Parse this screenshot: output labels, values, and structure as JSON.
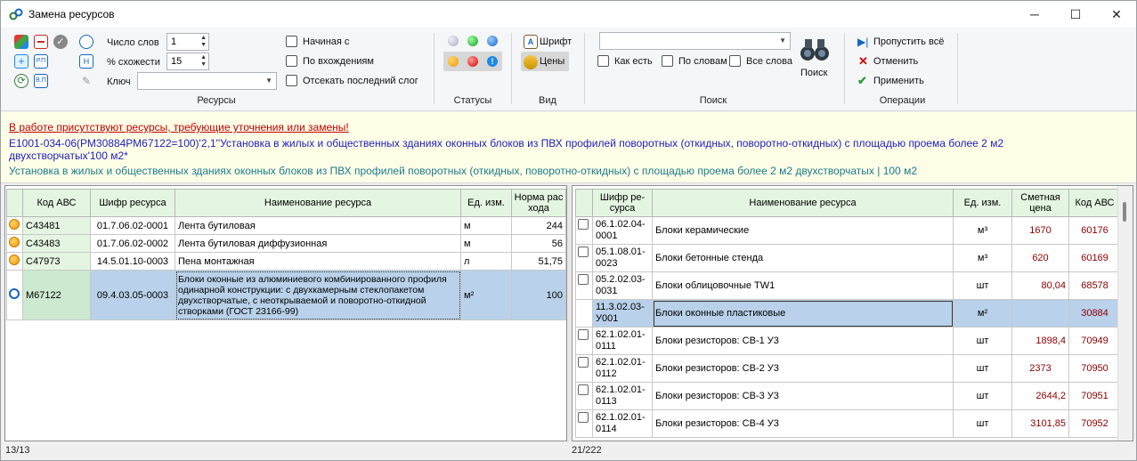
{
  "window": {
    "title": "Замена ресурсов",
    "minimize": "─",
    "maximize": "☐",
    "close": "✕"
  },
  "ribbon": {
    "resources": {
      "group_title": "Ресурсы",
      "word_count_label": "Число слов",
      "word_count_value": "1",
      "similarity_label": "% схожести",
      "similarity_value": "15",
      "key_label": "Ключ",
      "key_value": "",
      "starts_with_label": "Начиная с",
      "by_occurrence_label": "По вхождениям",
      "cut_last_syllable_label": "Отсекать последний слог",
      "small_buttons": [
        "Р.П",
        "В.П",
        "Н"
      ]
    },
    "statuses": {
      "group_title": "Статусы"
    },
    "view": {
      "group_title": "Вид",
      "font_label": "Шрифт",
      "prices_label": "Цены"
    },
    "search": {
      "group_title": "Поиск",
      "as_is_label": "Как есть",
      "by_words_label": "По словам",
      "all_words_label": "Все слова",
      "search_button": "Поиск",
      "search_value": ""
    },
    "operations": {
      "group_title": "Операции",
      "skip_all": "Пропустить всё",
      "cancel": "Отменить",
      "apply": "Применить"
    }
  },
  "info": {
    "warning": "В работе присутствуют ресурсы, требующие уточнения или замены!",
    "formula": "Е1001-034-06(РМ30884РМ67122=100)'2,1''Установка в жилых и общественных зданиях оконных блоков из ПВХ профилей поворотных (откидных, поворотно-откидных) с площадью проема более 2 м2 двухстворчатых'100 м2*",
    "description": "Установка в жилых и общественных зданиях оконных блоков из ПВХ профилей поворотных (откидных, поворотно-откидных) с площадью проема более 2 м2 двухстворчатых   |   100 м2"
  },
  "left_table": {
    "headers": [
      "Код АВС",
      "Шифр ресурса",
      "Наименование ресурса",
      "Ед. изм.",
      "Норма рас хода"
    ],
    "rows": [
      {
        "code": "С43481",
        "cipher": "01.7.06.02-0001",
        "name": "Лента бутиловая",
        "unit": "м",
        "norm": "244"
      },
      {
        "code": "С43483",
        "cipher": "01.7.06.02-0002",
        "name": "Лента бутиловая диффузионная",
        "unit": "м",
        "norm": "56"
      },
      {
        "code": "С47973",
        "cipher": "14.5.01.10-0003",
        "name": "Пена монтажная",
        "unit": "л",
        "norm": "51,75"
      },
      {
        "code": "М67122",
        "cipher": "09.4.03.05-0003",
        "name": "Блоки оконные из алюминиевого комбинированного профиля одинарной конструкции: с двухкамерным стеклопакетом двухстворчатые, с неоткрываемой и поворотно-откидной створками (ГОСТ 23166-99)",
        "unit": "м²",
        "norm": "100"
      }
    ],
    "status": "13/13"
  },
  "right_table": {
    "headers": [
      "Шифр ре-сурса",
      "Наименование ресурса",
      "Ед. изм.",
      "Сметная цена",
      "Код АВС"
    ],
    "rows": [
      {
        "cipher": "06.1.02.04-0001",
        "name": "Блоки керамические",
        "unit": "м³",
        "price": "1670",
        "code": "60176"
      },
      {
        "cipher": "05.1.08.01-0023",
        "name": "Блоки бетонные стенда",
        "unit": "м³",
        "price": "620",
        "code": "60169"
      },
      {
        "cipher": "05.2.02.03-0031",
        "name": "Блоки облицовочные TW1",
        "unit": "шт",
        "price": "80,04",
        "code": "68578"
      },
      {
        "cipher": "11.3.02.03-У001",
        "name": "Блоки оконные пластиковые",
        "unit": "м²",
        "price": "",
        "code": "30884"
      },
      {
        "cipher": "62.1.02.01-0111",
        "name": "Блоки резисторов: СВ-1 У3",
        "unit": "шт",
        "price": "1898,4",
        "code": "70949"
      },
      {
        "cipher": "62.1.02.01-0112",
        "name": "Блоки резисторов: СВ-2 У3",
        "unit": "шт",
        "price": "2373",
        "code": "70950"
      },
      {
        "cipher": "62.1.02.01-0113",
        "name": "Блоки резисторов: СВ-3 У3",
        "unit": "шт",
        "price": "2644,2",
        "code": "70951"
      },
      {
        "cipher": "62.1.02.01-0114",
        "name": "Блоки резисторов: СВ-4 У3",
        "unit": "шт",
        "price": "3101,85",
        "code": "70952"
      }
    ],
    "status": "21/222"
  }
}
